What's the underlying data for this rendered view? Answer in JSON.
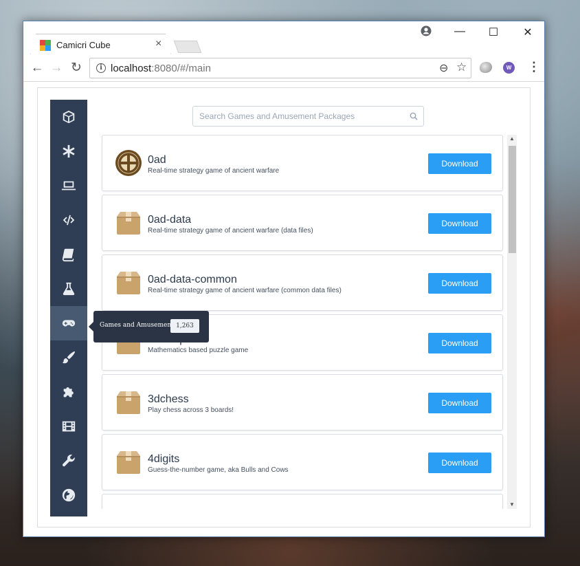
{
  "browser": {
    "tab_title": "Camicri Cube",
    "tab_close": "×",
    "url_host": "localhost",
    "url_rest": ":8080/#/main",
    "window_controls": {
      "minimize": "—",
      "maximize": "☐",
      "close": "✕"
    },
    "nav": {
      "back": "←",
      "forward": "→",
      "reload": "↻"
    },
    "info_glyph": "i",
    "zoom_glyph": "⊖",
    "star_glyph": "☆",
    "menu_glyph": "⋮",
    "extension_label": "W"
  },
  "search": {
    "placeholder": "Search Games and Amusement Packages"
  },
  "sidebar": {
    "items": [
      {
        "icon": "cube-icon"
      },
      {
        "icon": "asterisk-icon"
      },
      {
        "icon": "laptop-icon"
      },
      {
        "icon": "code-icon"
      },
      {
        "icon": "book-icon"
      },
      {
        "icon": "flask-icon"
      },
      {
        "icon": "gamepad-icon",
        "active": true
      },
      {
        "icon": "paintbrush-icon"
      },
      {
        "icon": "puzzle-icon"
      },
      {
        "icon": "film-icon"
      },
      {
        "icon": "wrench-icon"
      },
      {
        "icon": "globe-icon"
      }
    ]
  },
  "tooltip": {
    "label": "Games and Amusement",
    "count": "1,263"
  },
  "packages": [
    {
      "name": "0ad",
      "description": "Real-time strategy game of ancient warfare",
      "icon": "0ad-logo-icon",
      "button": "Download"
    },
    {
      "name": "0ad-data",
      "description": "Real-time strategy game of ancient warfare (data files)",
      "icon": "package-box-icon",
      "button": "Download"
    },
    {
      "name": "0ad-data-common",
      "description": "Real-time strategy game of ancient warfare (common data files)",
      "icon": "package-box-icon",
      "button": "Download"
    },
    {
      "name": "2048-qt",
      "description": "Mathematics based puzzle game",
      "icon": "package-box-icon",
      "button": "Download"
    },
    {
      "name": "3dchess",
      "description": "Play chess across 3 boards!",
      "icon": "package-box-icon",
      "button": "Download"
    },
    {
      "name": "4digits",
      "description": "Guess-the-number game, aka Bulls and Cows",
      "icon": "package-box-icon",
      "button": "Download"
    }
  ],
  "colors": {
    "sidebar": "#2f3e54",
    "sidebar_active": "#475a72",
    "accent": "#2a9df4",
    "tooltip": "#2a3444"
  }
}
